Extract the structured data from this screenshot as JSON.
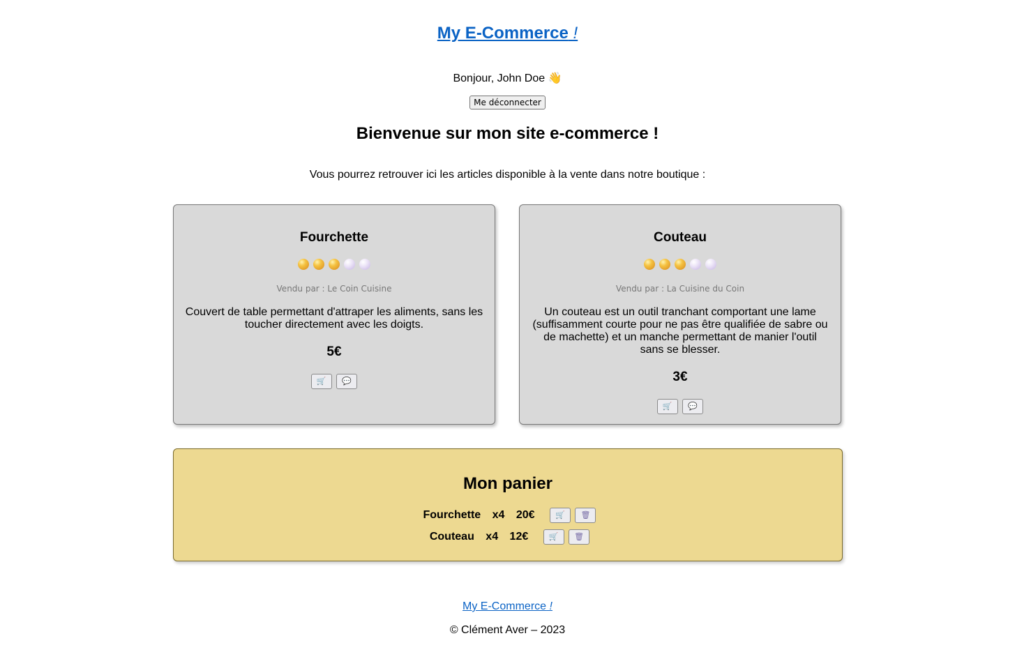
{
  "header": {
    "site_title": "My E-Commerce",
    "site_title_mark": "!",
    "greeting": "Bonjour, John Doe",
    "greeting_emoji": "👋",
    "logout_label": "Me déconnecter"
  },
  "main": {
    "welcome_title": "Bienvenue sur mon site e-commerce !",
    "intro_text": "Vous pourrez retrouver ici les articles disponible à la vente dans notre boutique :"
  },
  "products": [
    {
      "name": "Fourchette",
      "rating": 3,
      "rating_max": 5,
      "seller": "Vendu par : Le Coin Cuisine",
      "description": "Couvert de table permettant d'attraper les aliments, sans les toucher directement avec les doigts.",
      "price": "5€",
      "cart_icon": "🛒",
      "comment_icon": "💬"
    },
    {
      "name": "Couteau",
      "rating": 3,
      "rating_max": 5,
      "seller": "Vendu par : La Cuisine du Coin",
      "description": "Un couteau est un outil tranchant comportant une lame (suffisamment courte pour ne pas être qualifiée de sabre ou de machette) et un manche permettant de manier l'outil sans se blesser.",
      "price": "3€",
      "cart_icon": "🛒",
      "comment_icon": "💬"
    }
  ],
  "cart": {
    "title": "Mon panier",
    "items": [
      {
        "name": "Fourchette",
        "qty": "x4",
        "total": "20€",
        "cart_icon": "🛒",
        "trash_icon": "🗑"
      },
      {
        "name": "Couteau",
        "qty": "x4",
        "total": "12€",
        "cart_icon": "🛒",
        "trash_icon": "🗑"
      }
    ]
  },
  "footer": {
    "link_text": "My E-Commerce",
    "link_mark": "!",
    "copyright": "© Clément Aver – 2023"
  },
  "colors": {
    "link": "#0b63c5",
    "card_bg": "#d9d9d9",
    "cart_bg": "#edd991"
  }
}
